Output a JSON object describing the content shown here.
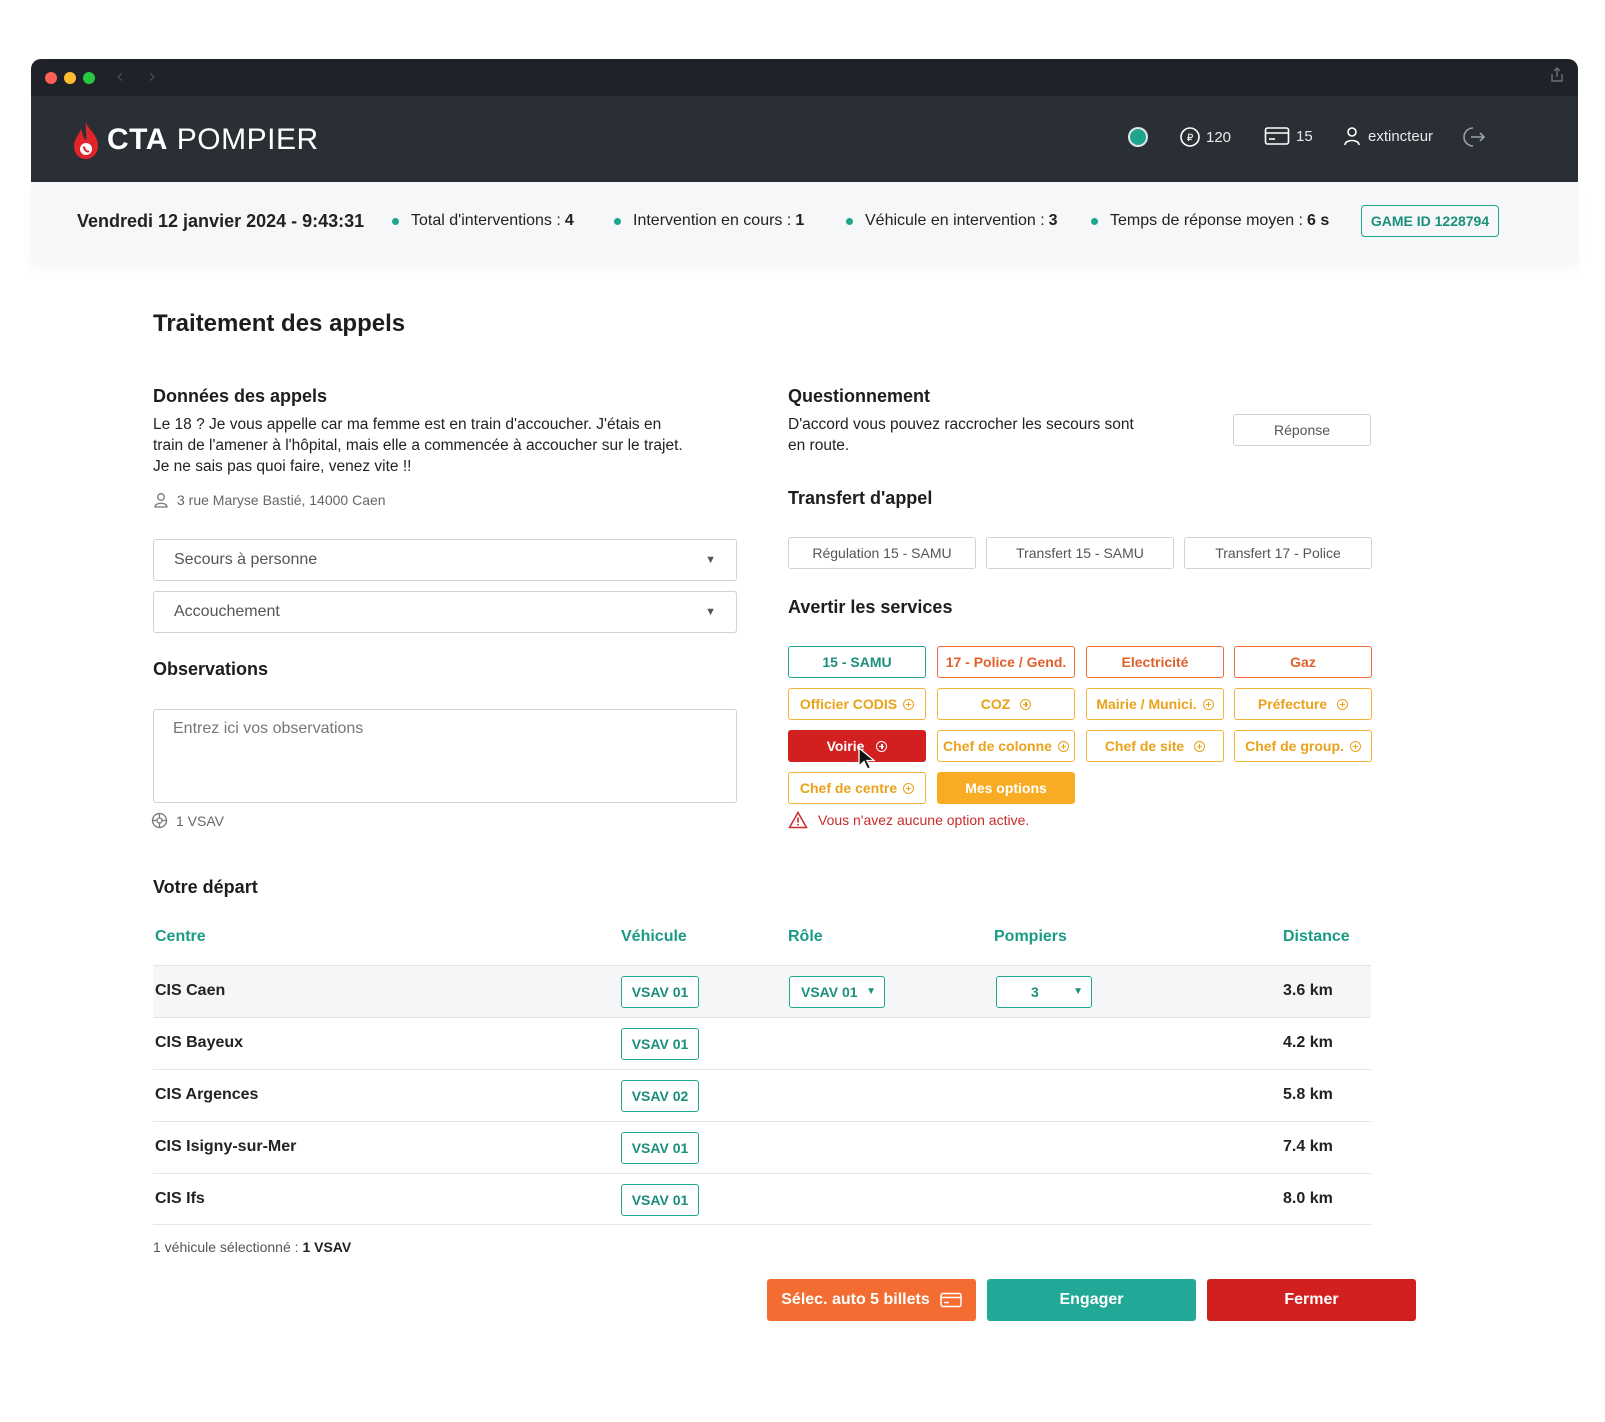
{
  "app": {
    "brand_strong": "CTA",
    "brand_light": "POMPIER",
    "coins": "120",
    "cards": "15",
    "username": "extincteur"
  },
  "status": {
    "datetime": "Vendredi 12 janvier 2024 - 9:43:31",
    "total_label": "Total d'interventions :",
    "total_value": "4",
    "current_label": "Intervention en cours :",
    "current_value": "1",
    "vehicle_label": "Véhicule en intervention :",
    "vehicle_value": "3",
    "response_label": "Temps de réponse moyen :",
    "response_value": "6 s",
    "game_id": "GAME ID 1228794"
  },
  "page": {
    "title": "Traitement des appels"
  },
  "call": {
    "heading": "Données des appels",
    "text": "Le 18 ? Je vous appelle car ma femme est en train d'accoucher. J'étais en train de l'amener à l'hôpital, mais elle a commencée à accoucher sur le trajet. Je ne sais pas quoi faire, venez vite !!",
    "address": "3 rue Maryse Bastié, 14000 Caen",
    "category": "Secours à personne",
    "subcategory": "Accouchement",
    "observations_heading": "Observations",
    "observations_placeholder": "Entrez ici vos observations",
    "vehicle_count": "1 VSAV"
  },
  "questioning": {
    "heading": "Questionnement",
    "text": "D'accord vous pouvez raccrocher les secours sont en route.",
    "response_button": "Réponse"
  },
  "transfer": {
    "heading": "Transfert d'appel",
    "buttons": [
      "Régulation 15 - SAMU",
      "Transfert 15 - SAMU",
      "Transfert 17 - Police"
    ]
  },
  "services": {
    "heading": "Avertir les services",
    "row1": [
      "15 - SAMU",
      "17 - Police / Gend.",
      "Electricité",
      "Gaz"
    ],
    "row2": [
      "Officier CODIS",
      "COZ",
      "Mairie / Munici.",
      "Préfecture"
    ],
    "row3": [
      "Voirie",
      "Chef de colonne",
      "Chef de site",
      "Chef de group."
    ],
    "row4": [
      "Chef de centre",
      "Mes options"
    ],
    "warning": "Vous n'avez aucune option active."
  },
  "departure": {
    "heading": "Votre départ",
    "columns": [
      "Centre",
      "Véhicule",
      "Rôle",
      "Pompiers",
      "Distance"
    ],
    "rows": [
      {
        "centre": "CIS Caen",
        "vehicle": "VSAV 01",
        "role": "VSAV 01",
        "pompiers": "3",
        "distance": "3.6 km"
      },
      {
        "centre": "CIS Bayeux",
        "vehicle": "VSAV 01",
        "distance": "4.2 km"
      },
      {
        "centre": "CIS Argences",
        "vehicle": "VSAV 02",
        "distance": "5.8 km"
      },
      {
        "centre": "CIS Isigny-sur-Mer",
        "vehicle": "VSAV 01",
        "distance": "7.4 km"
      },
      {
        "centre": "CIS Ifs",
        "vehicle": "VSAV 01",
        "distance": "8.0 km"
      }
    ],
    "selected_label": "1 véhicule sélectionné :",
    "selected_value": "1 VSAV"
  },
  "actions": {
    "auto": "Sélec. auto 5 billets",
    "engage": "Engager",
    "close": "Fermer"
  },
  "colors": {
    "teal": "#1fa58e",
    "red": "#d21f1f",
    "orange": "#f36d32",
    "yellow": "#f7ac23",
    "dark": "#2a2e35"
  }
}
